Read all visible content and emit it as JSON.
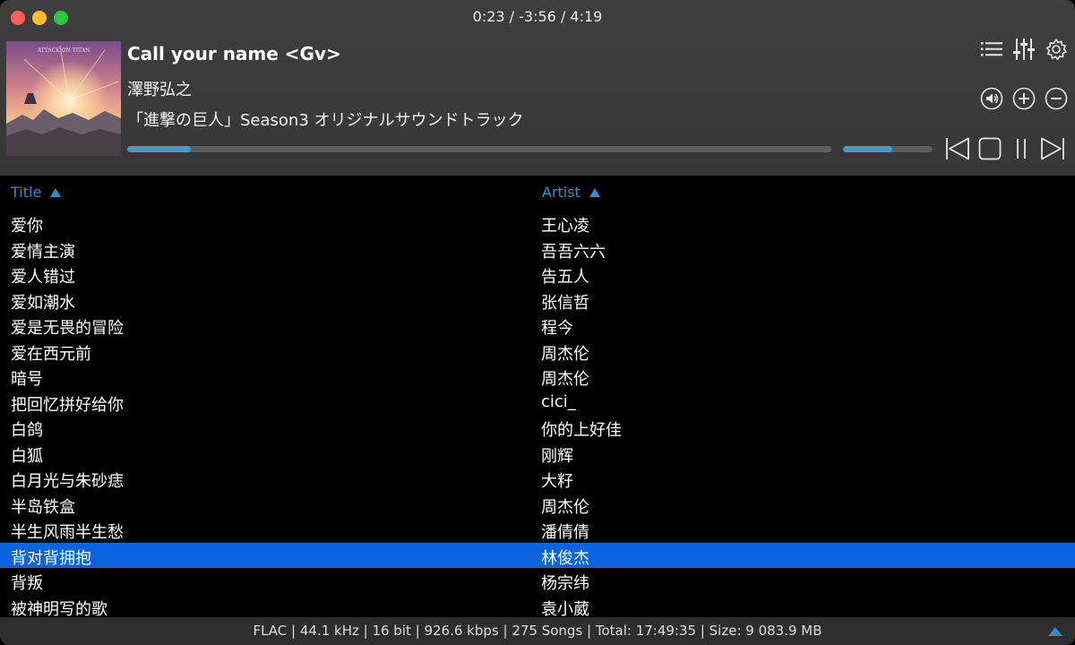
{
  "window": {
    "time_display": "0:23 / -3:56 / 4:19"
  },
  "now_playing": {
    "title": "Call your name <Gv>",
    "artist": "澤野弘之",
    "album": "「進撃の巨人」Season3 オリジナルサウンドトラック",
    "progress_fraction": 0.09,
    "volume_fraction": 0.55,
    "album_art": "album-cover-attack-on-titan"
  },
  "controls": {
    "playlist_icon": "list-icon",
    "equalizer_icon": "equalizer-icon",
    "settings_icon": "gear-icon",
    "mute_icon": "speaker-icon",
    "volume_up_icon": "plus-icon",
    "volume_down_icon": "minus-icon",
    "previous_icon": "previous-icon",
    "stop_icon": "stop-icon",
    "pause_icon": "pause-icon",
    "next_icon": "next-icon"
  },
  "playlist": {
    "columns": {
      "title": "Title",
      "artist": "Artist"
    },
    "rows": [
      {
        "title": "爱你",
        "artist": "王心凌"
      },
      {
        "title": "爱情主演",
        "artist": "吾吾六六"
      },
      {
        "title": "爱人错过",
        "artist": "告五人"
      },
      {
        "title": "爱如潮水",
        "artist": "张信哲"
      },
      {
        "title": "爱是无畏的冒险",
        "artist": "程今"
      },
      {
        "title": "爱在西元前",
        "artist": "周杰伦"
      },
      {
        "title": "暗号",
        "artist": "周杰伦"
      },
      {
        "title": "把回忆拼好给你",
        "artist": "cici_"
      },
      {
        "title": "白鸽",
        "artist": "你的上好佳"
      },
      {
        "title": "白狐",
        "artist": "刚辉"
      },
      {
        "title": "白月光与朱砂痣",
        "artist": "大籽"
      },
      {
        "title": "半岛铁盒",
        "artist": "周杰伦"
      },
      {
        "title": "半生风雨半生愁",
        "artist": "潘倩倩"
      },
      {
        "title": "背对背拥抱",
        "artist": "林俊杰",
        "selected": true
      },
      {
        "title": "背叛",
        "artist": "杨宗纬"
      },
      {
        "title": "被神明写的歌",
        "artist": "袁小葳"
      }
    ]
  },
  "status": {
    "text": "FLAC | 44.1 kHz | 16 bit | 926.6 kbps | 275 Songs | Total: 17:49:35 | Size: 9 083.9 MB"
  },
  "colors": {
    "accent": "#3a9fd6",
    "selection": "#0a64e0",
    "header_bg": "#3c3c3c"
  }
}
